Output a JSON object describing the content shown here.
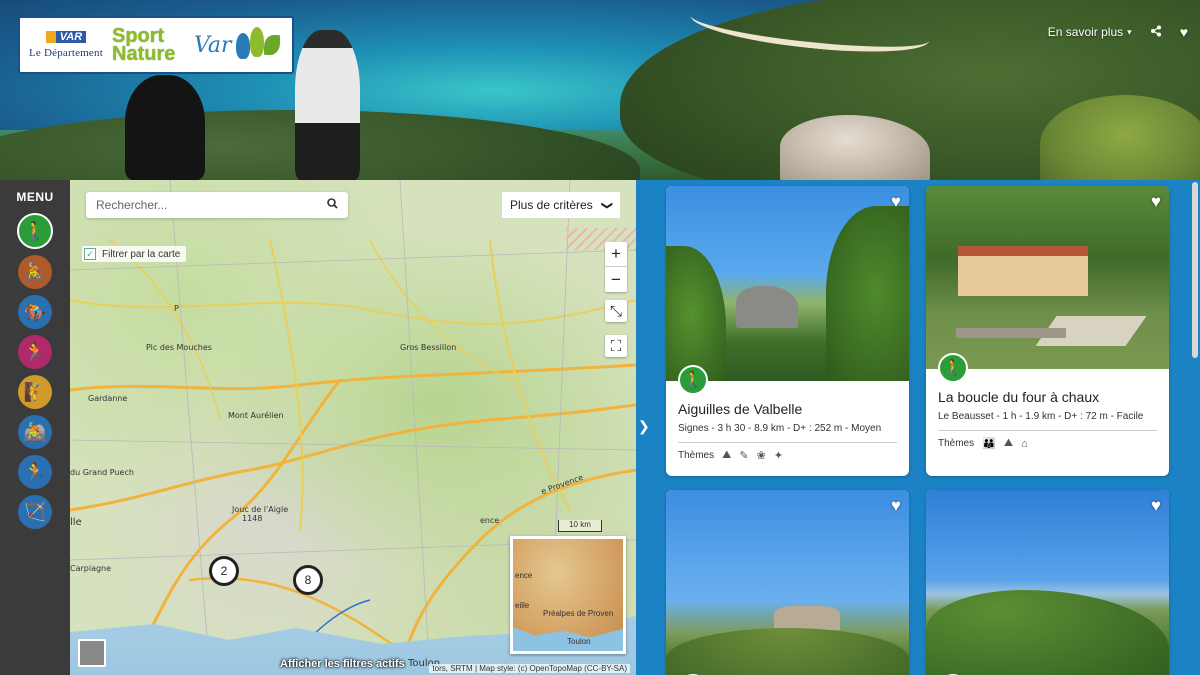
{
  "header": {
    "logo": {
      "dept_badge": "VAR",
      "dept_text": "Le Département",
      "brand_line1": "Sport",
      "brand_line2": "Nature",
      "brand_var": "Var"
    },
    "more_label": "En savoir plus",
    "more_caret": "▾",
    "share_icon": "⟨",
    "favorite_icon": "♥"
  },
  "sidebar": {
    "menu_label": "MENU",
    "items": [
      {
        "name": "hiking",
        "icon": "🚶",
        "color": "#2a9c38"
      },
      {
        "name": "cycling-road",
        "icon": "🚴",
        "color": "#b05a2a"
      },
      {
        "name": "horse-riding",
        "icon": "🏇",
        "color": "#2a6fb0"
      },
      {
        "name": "trail-running",
        "icon": "🏃",
        "color": "#b02a6a"
      },
      {
        "name": "climbing",
        "icon": "🧗",
        "color": "#d09a2a"
      },
      {
        "name": "mountain-bike",
        "icon": "🚵",
        "color": "#2a6fb0"
      },
      {
        "name": "running",
        "icon": "🏃",
        "color": "#2a6fb0"
      },
      {
        "name": "archery",
        "icon": "🏹",
        "color": "#2a6fb0"
      }
    ]
  },
  "map": {
    "search_placeholder": "Rechercher...",
    "criteria_label": "Plus de critères",
    "criteria_caret": "❯",
    "filter_label": "Filtrer par la carte",
    "filter_checked": "✓",
    "zoom_in": "+",
    "zoom_out": "−",
    "fit_icon": "⤡",
    "fullscreen_icon": "⛶",
    "places": [
      "Pic des Mouches",
      "Gros Bessillon",
      "Gardanne",
      "Mont Aurélien",
      "du Grand Puech",
      "Jouc de l'Aigle",
      "1148",
      "Carpiagne",
      "Toulon",
      "lle",
      "ence",
      "e Provence",
      "P"
    ],
    "clusters": [
      "2",
      "8"
    ],
    "scale": "10 km",
    "minimap": {
      "label1": "ence",
      "label2": "eille",
      "label3": "Préalpes de Proven",
      "label4": "Toulon"
    },
    "active_filters": "Afficher les filtres actifs",
    "attribution": "tors, SRTM | Map style: (c) OpenTopoMap (CC-BY-SA)",
    "collapse_icon": "❯"
  },
  "results": {
    "cards": [
      {
        "title": "Aiguilles de Valbelle",
        "meta": "Signes  -  3 h 30  -  8.9 km  -  D+ : 252 m  -  Moyen",
        "themes_label": "Thèmes",
        "theme_icons": [
          "⛰",
          "✎",
          "❀",
          "✦"
        ]
      },
      {
        "title": "La boucle du four à chaux",
        "meta": "Le Beausset  -  1 h  -  1.9 km  -  D+ : 72 m  -  Facile",
        "themes_label": "Thèmes",
        "theme_icons": [
          "👪",
          "⛰",
          "⌂"
        ]
      },
      {
        "title": "",
        "meta": "",
        "themes_label": "",
        "theme_icons": []
      },
      {
        "title": "",
        "meta": "",
        "themes_label": "",
        "theme_icons": []
      }
    ],
    "fav_icon": "♥",
    "badge_icon": "🚶"
  }
}
